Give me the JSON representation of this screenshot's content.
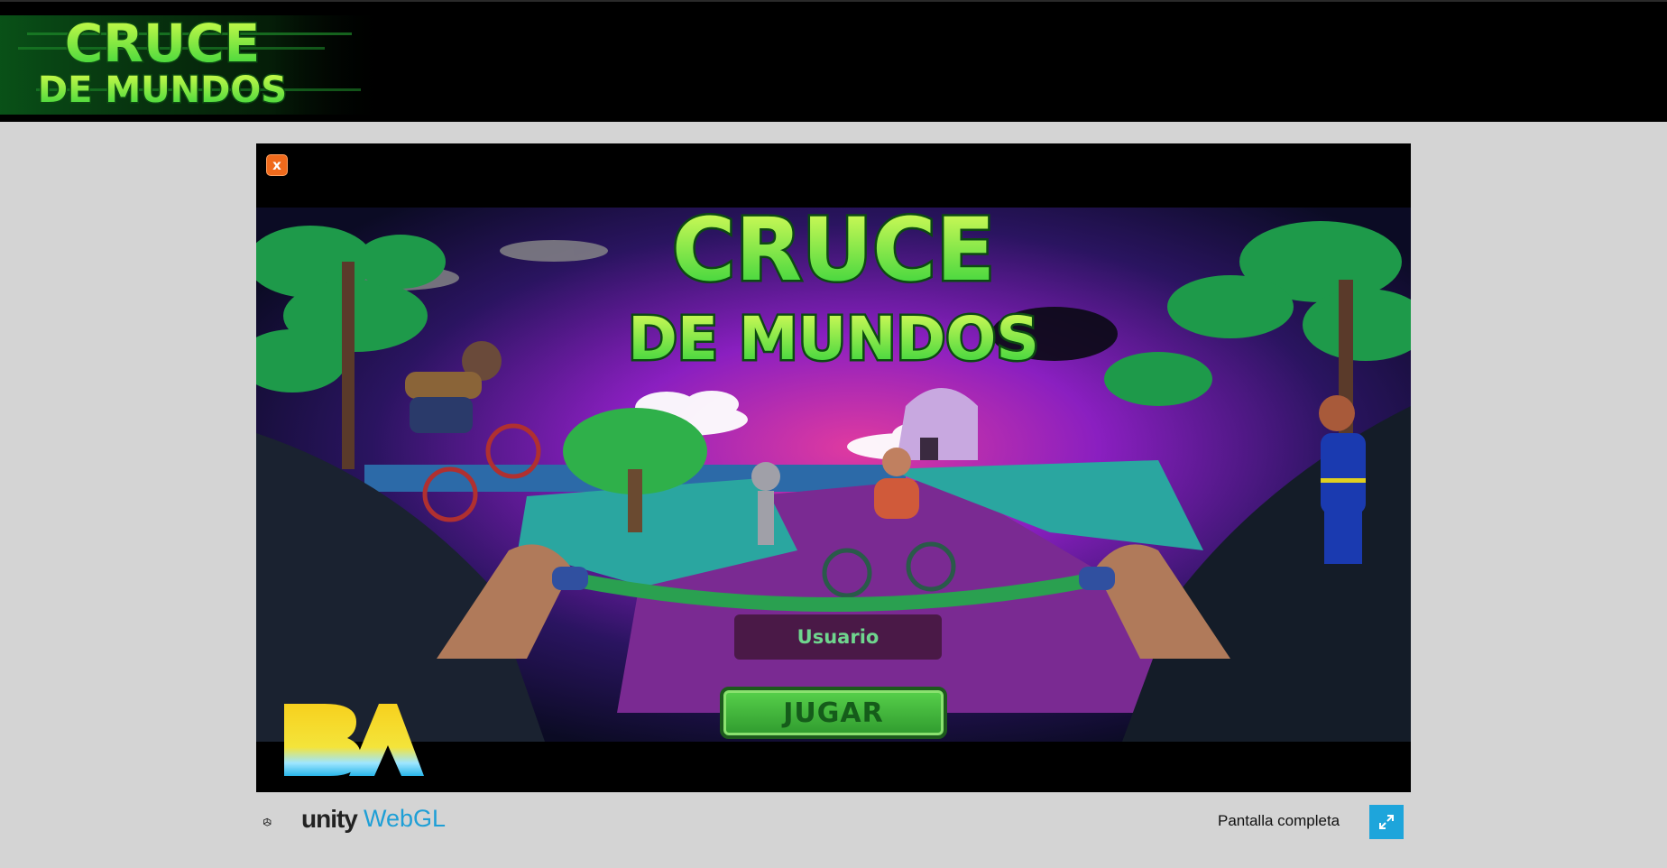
{
  "header": {
    "logo_line1": "CRUCE",
    "logo_line2": "DE MUNDOS"
  },
  "game": {
    "close_label": "x",
    "title_line1": "CRUCE",
    "title_line2": "DE MUNDOS",
    "user_placeholder": "Usuario",
    "play_label": "JUGAR",
    "sponsor_logo_text": "BA"
  },
  "footer": {
    "unity_label": "unity",
    "webgl_label": "WebGL",
    "fullscreen_label": "Pantalla completa"
  },
  "icons": {
    "close": "close-icon",
    "fullscreen": "fullscreen-icon",
    "unity": "unity-logo-icon"
  },
  "colors": {
    "page_background": "#d4d4d4",
    "header_background": "#000000",
    "title_green": "#4be04a",
    "close_orange": "#f06a1c",
    "fullscreen_blue": "#1ea5db",
    "webgl_blue": "#1e9fd6"
  }
}
